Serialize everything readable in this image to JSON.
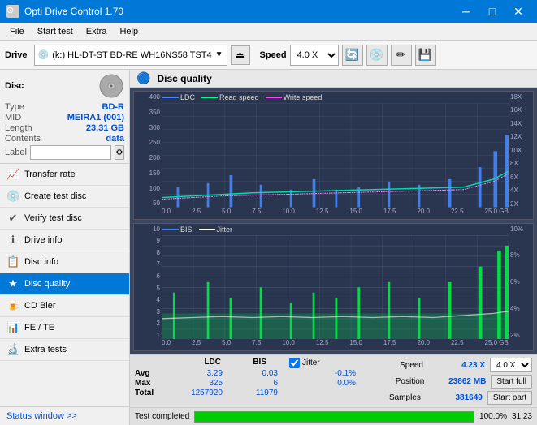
{
  "titlebar": {
    "title": "Opti Drive Control 1.70",
    "icon": "⊙"
  },
  "menubar": {
    "items": [
      "File",
      "Start test",
      "Extra",
      "Help"
    ]
  },
  "toolbar": {
    "drive_label": "Drive",
    "drive_value": "(k:) HL-DT-ST BD-RE  WH16NS58 TST4",
    "speed_label": "Speed",
    "speed_value": "4.0 X"
  },
  "disc": {
    "label": "Disc",
    "type_label": "Type",
    "type_value": "BD-R",
    "mid_label": "MID",
    "mid_value": "MEIRA1 (001)",
    "length_label": "Length",
    "length_value": "23,31 GB",
    "contents_label": "Contents",
    "contents_value": "data",
    "label_label": "Label",
    "label_value": ""
  },
  "nav": {
    "items": [
      {
        "id": "transfer-rate",
        "label": "Transfer rate",
        "icon": "📈"
      },
      {
        "id": "create-test-disc",
        "label": "Create test disc",
        "icon": "💿"
      },
      {
        "id": "verify-test-disc",
        "label": "Verify test disc",
        "icon": "✔"
      },
      {
        "id": "drive-info",
        "label": "Drive info",
        "icon": "ℹ"
      },
      {
        "id": "disc-info",
        "label": "Disc info",
        "icon": "📋"
      },
      {
        "id": "disc-quality",
        "label": "Disc quality",
        "icon": "★",
        "active": true
      },
      {
        "id": "cd-bier",
        "label": "CD Bier",
        "icon": "🍺"
      },
      {
        "id": "fe-te",
        "label": "FE / TE",
        "icon": "📊"
      },
      {
        "id": "extra-tests",
        "label": "Extra tests",
        "icon": "🔬"
      }
    ],
    "status_window": "Status window >>"
  },
  "chart": {
    "title": "Disc quality",
    "top_legend": [
      {
        "label": "LDC",
        "color": "#0050ff"
      },
      {
        "label": "Read speed",
        "color": "#00ff00"
      },
      {
        "label": "Write speed",
        "color": "#ff00ff"
      }
    ],
    "top_y_labels": [
      "400",
      "350",
      "300",
      "250",
      "200",
      "150",
      "100",
      "50"
    ],
    "top_y_right_labels": [
      "18X",
      "16X",
      "14X",
      "12X",
      "10X",
      "8X",
      "6X",
      "4X",
      "2X"
    ],
    "x_labels": [
      "0.0",
      "2.5",
      "5.0",
      "7.5",
      "10.0",
      "12.5",
      "15.0",
      "17.5",
      "20.0",
      "22.5",
      "25.0 GB"
    ],
    "bottom_legend": [
      {
        "label": "BIS",
        "color": "#0050ff"
      },
      {
        "label": "Jitter",
        "color": "#ffffff"
      }
    ],
    "bottom_y_labels": [
      "10",
      "9",
      "8",
      "7",
      "6",
      "5",
      "4",
      "3",
      "2",
      "1"
    ],
    "bottom_y_right_labels": [
      "10%",
      "8%",
      "6%",
      "4%",
      "2%"
    ]
  },
  "stats": {
    "headers": [
      "",
      "LDC",
      "BIS",
      "",
      "Jitter",
      "Speed",
      "",
      ""
    ],
    "avg_label": "Avg",
    "avg_ldc": "3.29",
    "avg_bis": "0.03",
    "avg_jitter": "-0.1%",
    "max_label": "Max",
    "max_ldc": "325",
    "max_bis": "6",
    "max_jitter": "0.0%",
    "total_label": "Total",
    "total_ldc": "1257920",
    "total_bis": "11979",
    "jitter_checked": true,
    "jitter_label": "Jitter",
    "speed_label": "Speed",
    "speed_value": "4.23 X",
    "speed_select": "4.0 X",
    "position_label": "Position",
    "position_value": "23862 MB",
    "samples_label": "Samples",
    "samples_value": "381649",
    "start_full": "Start full",
    "start_part": "Start part"
  },
  "progressbar": {
    "percent": 100,
    "percent_label": "100.0%",
    "status": "Test completed",
    "time": "31:23"
  }
}
